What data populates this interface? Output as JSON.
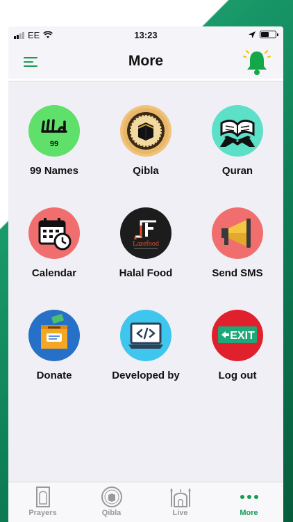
{
  "status": {
    "carrier": "EE",
    "time": "13:23"
  },
  "header": {
    "title": "More"
  },
  "menu": {
    "items": [
      {
        "label": "99 Names",
        "badge": "99"
      },
      {
        "label": "Qibla"
      },
      {
        "label": "Quran"
      },
      {
        "label": "Calendar"
      },
      {
        "label": "Halal Food",
        "logo_text": "Lazefood"
      },
      {
        "label": "Send SMS"
      },
      {
        "label": "Donate"
      },
      {
        "label": "Developed by"
      },
      {
        "label": "Log out",
        "sign_text": "EXIT"
      }
    ]
  },
  "tabs": [
    {
      "label": "Prayers"
    },
    {
      "label": "Qibla"
    },
    {
      "label": "Live"
    },
    {
      "label": "More",
      "active": true
    }
  ],
  "colors": {
    "accent": "#1a9a55"
  }
}
